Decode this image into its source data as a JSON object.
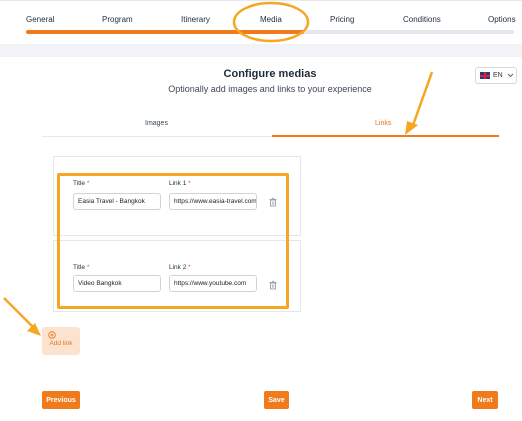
{
  "steps": [
    "General",
    "Program",
    "Itinerary",
    "Media",
    "Pricing",
    "Conditions",
    "Options"
  ],
  "progress_fraction": 0.57,
  "language": "EN",
  "header": {
    "title": "Configure medias",
    "subtitle": "Optionally add images and links to your experience"
  },
  "tabs": {
    "images": "Images",
    "links": "Links"
  },
  "links": [
    {
      "title_label": "Title",
      "link_label": "Link 1",
      "title_value": "Easia Travel - Bangkok",
      "link_value": "https://www.easia-travel.com"
    },
    {
      "title_label": "Title",
      "link_label": "Link 2",
      "title_value": "Video Bangkok",
      "link_value": "https://www.youtube.com"
    }
  ],
  "required_mark": "*",
  "add_link_label": "Add link",
  "buttons": {
    "previous": "Previous",
    "save": "Save",
    "next": "Next"
  },
  "colors": {
    "accent": "#f07b1c",
    "highlight": "#f5a623"
  }
}
